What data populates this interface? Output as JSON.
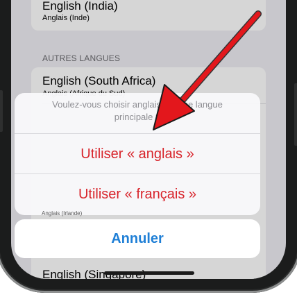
{
  "settings": {
    "row_india_title": "English (India)",
    "row_india_sub": "Anglais (Inde)",
    "section_other": "AUTRES LANGUES",
    "row_south_africa_title": "English (South Africa)",
    "row_south_africa_sub": "Anglais (Afrique du Sud)",
    "row_partial_label": "Anglais (Irlande)",
    "row_singapore_title": "English (Singapore)"
  },
  "action_sheet": {
    "message_line1": "Voulez-vous choisir anglais comme langue",
    "message_line2": "principale ?",
    "option_english": "Utiliser « anglais »",
    "option_french": "Utiliser « français »",
    "cancel": "Annuler"
  },
  "colors": {
    "destructive": "#d8242b",
    "cancel_blue": "#1f7fd6",
    "arrow_red": "#e3171c"
  }
}
